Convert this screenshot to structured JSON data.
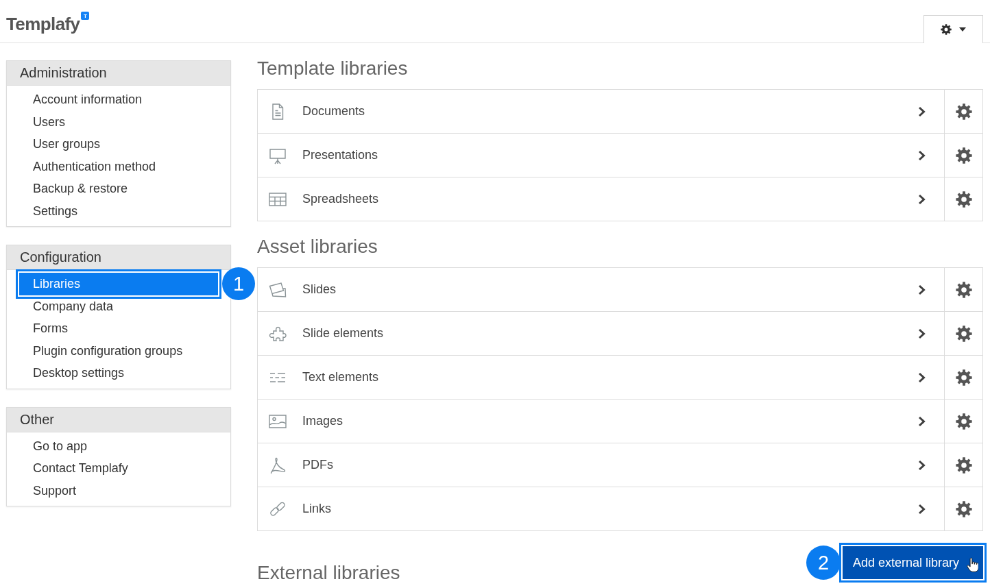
{
  "header": {
    "logo": "Templafy",
    "logo_badge": "T"
  },
  "sidebar": {
    "sections": [
      {
        "title": "Administration",
        "items": [
          {
            "label": "Account information",
            "selected": false
          },
          {
            "label": "Users",
            "selected": false
          },
          {
            "label": "User groups",
            "selected": false
          },
          {
            "label": "Authentication method",
            "selected": false
          },
          {
            "label": "Backup & restore",
            "selected": false
          },
          {
            "label": "Settings",
            "selected": false
          }
        ]
      },
      {
        "title": "Configuration",
        "items": [
          {
            "label": "Libraries",
            "selected": true,
            "callout": "1"
          },
          {
            "label": "Company data",
            "selected": false
          },
          {
            "label": "Forms",
            "selected": false
          },
          {
            "label": "Plugin configuration groups",
            "selected": false
          },
          {
            "label": "Desktop settings",
            "selected": false
          }
        ]
      },
      {
        "title": "Other",
        "items": [
          {
            "label": "Go to app",
            "selected": false
          },
          {
            "label": "Contact Templafy",
            "selected": false
          },
          {
            "label": "Support",
            "selected": false
          }
        ]
      }
    ]
  },
  "main": {
    "sections": [
      {
        "title": "Template libraries",
        "rows": [
          "Documents",
          "Presentations",
          "Spreadsheets"
        ]
      },
      {
        "title": "Asset libraries",
        "rows": [
          "Slides",
          "Slide elements",
          "Text elements",
          "Images",
          "PDFs",
          "Links"
        ]
      },
      {
        "title": "External libraries",
        "action": {
          "label": "Add external library",
          "callout": "2"
        }
      }
    ]
  }
}
